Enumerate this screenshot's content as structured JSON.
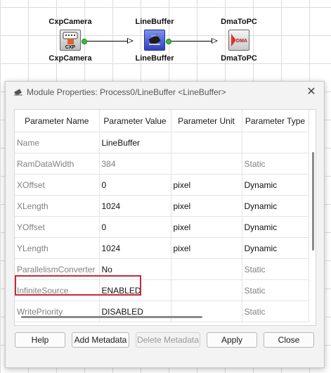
{
  "pipeline": {
    "nodes": [
      {
        "title": "CxpCamera",
        "subtitle": "CxpCamera",
        "icon": "camera-icon",
        "icon_text": "CXP"
      },
      {
        "title": "LineBuffer",
        "subtitle": "LineBuffer",
        "icon": "chip-icon"
      },
      {
        "title": "DmaToPC",
        "subtitle": "DmaToPC",
        "icon": "dma-icon",
        "icon_text": "DMA"
      }
    ]
  },
  "dialog": {
    "title": "Module Properties: Process0/LineBuffer <LineBuffer>",
    "close_glyph": "✕",
    "columns": [
      "Parameter Name",
      "Parameter Value",
      "Parameter Unit",
      "Parameter Type"
    ],
    "rows": [
      {
        "name": "Name",
        "value": "LineBuffer",
        "unit": "",
        "type": "",
        "readonly": false
      },
      {
        "name": "RamDataWidth",
        "value": "384",
        "unit": "",
        "type": "Static",
        "readonly": true
      },
      {
        "name": "XOffset",
        "value": "0",
        "unit": "pixel",
        "type": "Dynamic",
        "readonly": false
      },
      {
        "name": "XLength",
        "value": "1024",
        "unit": "pixel",
        "type": "Dynamic",
        "readonly": false
      },
      {
        "name": "YOffset",
        "value": "0",
        "unit": "pixel",
        "type": "Dynamic",
        "readonly": false
      },
      {
        "name": "YLength",
        "value": "1024",
        "unit": "pixel",
        "type": "Dynamic",
        "readonly": false
      },
      {
        "name": "ParallelismConverter",
        "value": "No",
        "unit": "",
        "type": "Static",
        "readonly": false
      },
      {
        "name": "InfiniteSource",
        "value": "ENABLED",
        "unit": "",
        "type": "Static",
        "readonly": false
      },
      {
        "name": "WritePriority",
        "value": "DISABLED",
        "unit": "",
        "type": "Static",
        "readonly": false
      }
    ],
    "buttons": {
      "help": "Help",
      "add_metadata": "Add Metadata",
      "delete_metadata": "Delete Metadata",
      "apply": "Apply",
      "close": "Close"
    },
    "highlight_color": "#c8283a"
  }
}
